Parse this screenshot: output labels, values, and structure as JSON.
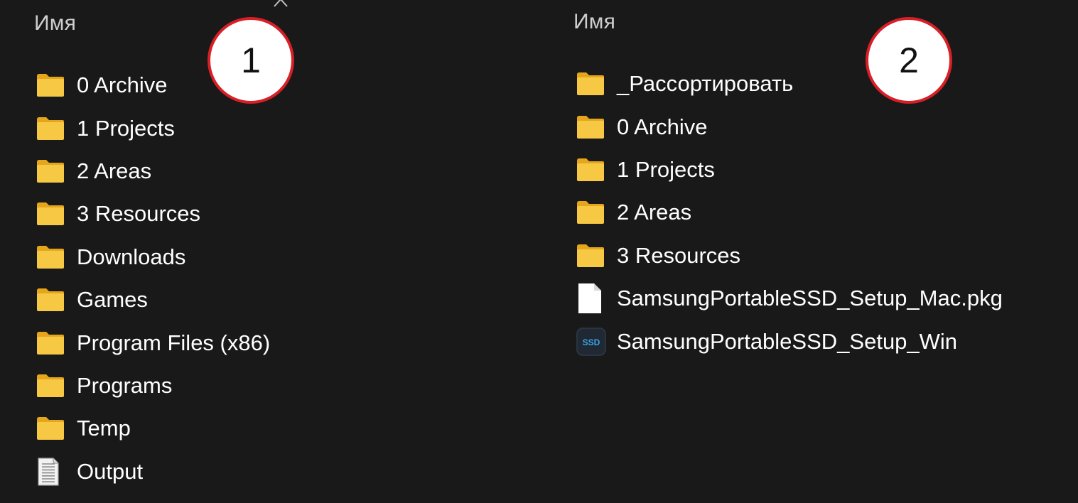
{
  "pane1": {
    "column_header": "Имя",
    "badge": "1",
    "items": [
      {
        "name": "0 Archive",
        "type": "folder"
      },
      {
        "name": "1 Projects",
        "type": "folder"
      },
      {
        "name": "2 Areas",
        "type": "folder"
      },
      {
        "name": "3 Resources",
        "type": "folder"
      },
      {
        "name": "Downloads",
        "type": "folder"
      },
      {
        "name": "Games",
        "type": "folder"
      },
      {
        "name": "Program Files (x86)",
        "type": "folder"
      },
      {
        "name": "Programs",
        "type": "folder"
      },
      {
        "name": "Temp",
        "type": "folder"
      },
      {
        "name": "Output",
        "type": "text-file"
      }
    ]
  },
  "pane2": {
    "column_header": "Имя",
    "badge": "2",
    "items": [
      {
        "name": "_Рассортировать",
        "type": "folder"
      },
      {
        "name": "0 Archive",
        "type": "folder"
      },
      {
        "name": "1 Projects",
        "type": "folder"
      },
      {
        "name": "2 Areas",
        "type": "folder"
      },
      {
        "name": "3 Resources",
        "type": "folder"
      },
      {
        "name": "SamsungPortableSSD_Setup_Mac.pkg",
        "type": "blank-file"
      },
      {
        "name": "SamsungPortableSSD_Setup_Win",
        "type": "app"
      }
    ]
  },
  "icons": {
    "folder": "folder-icon",
    "text-file": "text-document-icon",
    "blank-file": "blank-file-icon",
    "app": "ssd-app-icon",
    "app_text": "SSD"
  },
  "colors": {
    "background": "#191919",
    "folder_main": "#f7c844",
    "folder_back": "#e5a61c",
    "badge_border": "#d81f26",
    "badge_fill": "#ffffff"
  }
}
